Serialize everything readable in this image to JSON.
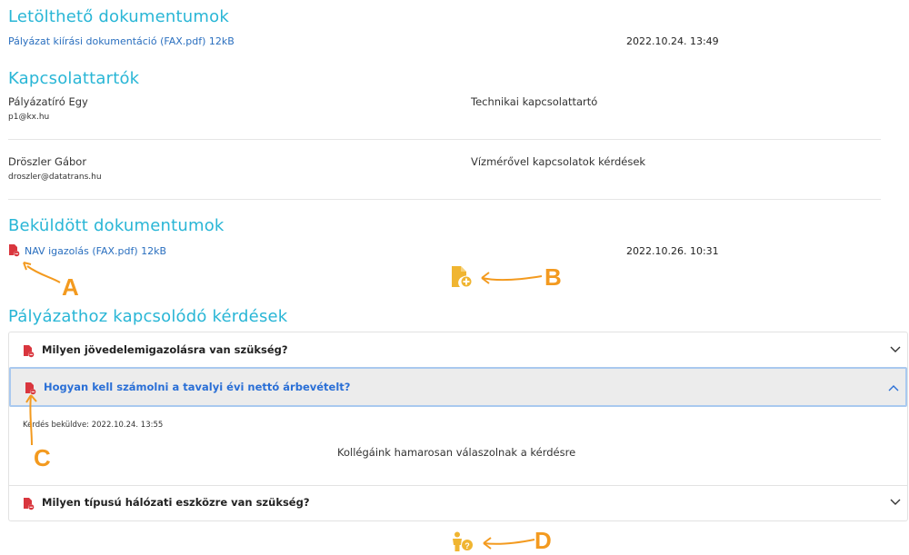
{
  "downloadable": {
    "heading": "Letölthető dokumentumok",
    "file_link": "Pályázat kiírási dokumentáció (FAX.pdf) 12kB",
    "date": "2022.10.24. 13:49"
  },
  "contacts": {
    "heading": "Kapcsolattartók",
    "items": [
      {
        "name": "Pályázatíró Egy",
        "email": "p1@kx.hu",
        "role": "Technikai kapcsolattartó"
      },
      {
        "name": "Dröszler Gábor",
        "email": "droszler@datatrans.hu",
        "role": "Vízmérővel kapcsolatok kérdések"
      }
    ]
  },
  "submitted": {
    "heading": "Beküldött dokumentumok",
    "file_link": "NAV igazolás (FAX.pdf) 12kB",
    "date": "2022.10.26. 10:31"
  },
  "questions": {
    "heading": "Pályázathoz kapcsolódó kérdések",
    "items": [
      {
        "text": "Milyen jövedelemigazolásra van szükség?",
        "expanded": false
      },
      {
        "text": "Hogyan kell számolni a tavalyi évi nettó árbevételt?",
        "expanded": true,
        "sent_label": "Kérdés beküldve: 2022.10.24. 13:55",
        "answer": "Kollégáink hamarosan válaszolnak a kérdésre"
      },
      {
        "text": "Milyen típusú hálózati eszközre van szükség?",
        "expanded": false
      }
    ]
  },
  "annotations": {
    "a": "A",
    "b": "B",
    "c": "C",
    "d": "D"
  },
  "colors": {
    "accent": "#29b6d6",
    "link": "#2a6fbf",
    "pdf_red": "#d9363e",
    "annotation": "#f39a1f",
    "active_bg": "#ececec",
    "active_border": "#a9c9ef"
  }
}
